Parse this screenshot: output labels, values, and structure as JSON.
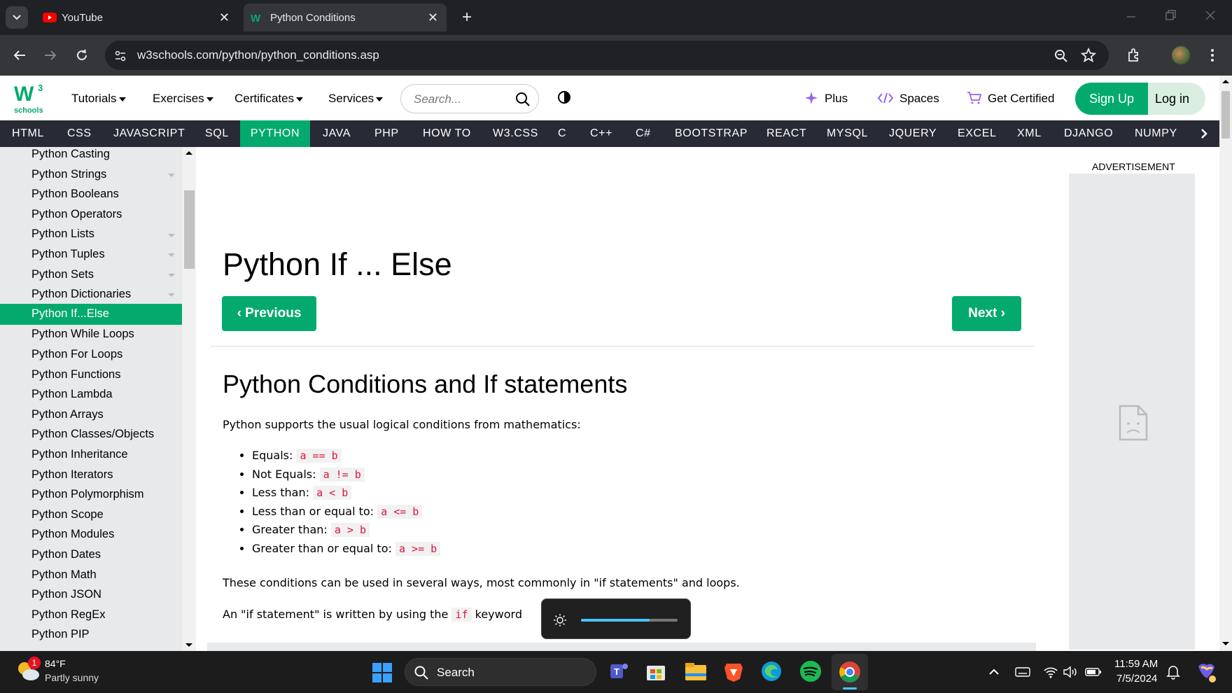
{
  "browser": {
    "tabs": [
      {
        "title": "YouTube",
        "active": false
      },
      {
        "title": "Python Conditions",
        "active": true
      }
    ],
    "url": "w3schools.com/python/python_conditions.asp"
  },
  "header": {
    "logo_text": "schools",
    "logo_superscript": "3",
    "menus": [
      "Tutorials",
      "Exercises",
      "Certificates",
      "Services"
    ],
    "search_placeholder": "Search...",
    "plus": "Plus",
    "spaces": "Spaces",
    "get_certified": "Get Certified",
    "sign_up": "Sign Up",
    "log_in": "Log in"
  },
  "topnav": [
    "HTML",
    "CSS",
    "JAVASCRIPT",
    "SQL",
    "PYTHON",
    "JAVA",
    "PHP",
    "HOW TO",
    "W3.CSS",
    "C",
    "C++",
    "C#",
    "BOOTSTRAP",
    "REACT",
    "MYSQL",
    "JQUERY",
    "EXCEL",
    "XML",
    "DJANGO",
    "NUMPY"
  ],
  "sidebar": [
    "Python Casting",
    "Python Strings",
    "Python Booleans",
    "Python Operators",
    "Python Lists",
    "Python Tuples",
    "Python Sets",
    "Python Dictionaries",
    "Python If...Else",
    "Python While Loops",
    "Python For Loops",
    "Python Functions",
    "Python Lambda",
    "Python Arrays",
    "Python Classes/Objects",
    "Python Inheritance",
    "Python Iterators",
    "Python Polymorphism",
    "Python Scope",
    "Python Modules",
    "Python Dates",
    "Python Math",
    "Python JSON",
    "Python RegEx",
    "Python PIP"
  ],
  "main": {
    "title": "Python If ... Else",
    "previous": "Previous",
    "next": "Next",
    "subtitle": "Python Conditions and If statements",
    "intro": "Python supports the usual logical conditions from mathematics:",
    "conditions": [
      {
        "label": "Equals:",
        "code": "a == b"
      },
      {
        "label": "Not Equals:",
        "code": "a != b"
      },
      {
        "label": "Less than:",
        "code": "a < b"
      },
      {
        "label": "Less than or equal to:",
        "code": "a <= b"
      },
      {
        "label": "Greater than:",
        "code": "a > b"
      },
      {
        "label": "Greater than or equal to:",
        "code": "a >= b"
      }
    ],
    "para2": "These conditions can be used in several ways, most commonly in \"if statements\" and loops.",
    "para3_before": "An \"if statement\" is written by using the",
    "para3_code": "if",
    "para3_after": "keyword"
  },
  "ad": {
    "label": "ADVERTISEMENT"
  },
  "osd": {
    "brightness": 0.71
  },
  "taskbar": {
    "weather_temp": "84°F",
    "weather_desc": "Partly sunny",
    "weather_badge": "1",
    "search": "Search",
    "time": "11:59 AM",
    "date": "7/5/2024"
  },
  "colors": {
    "w3_green": "#04aa6d",
    "nav_dark": "#282a35",
    "code_red": "#dc143c"
  }
}
